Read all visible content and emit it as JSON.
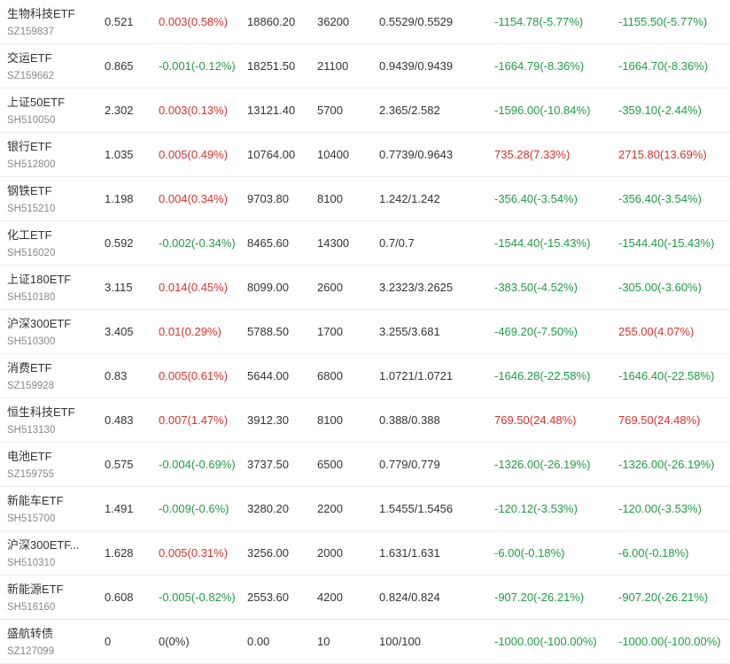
{
  "colors": {
    "up": "#d9312e",
    "down": "#1f9c45",
    "neutral": "#333333"
  },
  "rows": [
    {
      "name": "生物科技ETF",
      "code": "SZ159837",
      "price": "0.521",
      "change": "0.003(0.58%)",
      "change_dir": "up",
      "market_value": "18860.20",
      "shares": "36200",
      "cost": "0.5529/0.5529",
      "pnl": "-1154.78(-5.77%)",
      "pnl_dir": "down",
      "total_pnl": "-1155.50(-5.77%)",
      "total_pnl_dir": "down"
    },
    {
      "name": "交运ETF",
      "code": "SZ159662",
      "price": "0.865",
      "change": "-0.001(-0.12%)",
      "change_dir": "down",
      "market_value": "18251.50",
      "shares": "21100",
      "cost": "0.9439/0.9439",
      "pnl": "-1664.79(-8.36%)",
      "pnl_dir": "down",
      "total_pnl": "-1664.70(-8.36%)",
      "total_pnl_dir": "down"
    },
    {
      "name": "上证50ETF",
      "code": "SH510050",
      "price": "2.302",
      "change": "0.003(0.13%)",
      "change_dir": "up",
      "market_value": "13121.40",
      "shares": "5700",
      "cost": "2.365/2.582",
      "pnl": "-1596.00(-10.84%)",
      "pnl_dir": "down",
      "total_pnl": "-359.10(-2.44%)",
      "total_pnl_dir": "down"
    },
    {
      "name": "银行ETF",
      "code": "SH512800",
      "price": "1.035",
      "change": "0.005(0.49%)",
      "change_dir": "up",
      "market_value": "10764.00",
      "shares": "10400",
      "cost": "0.7739/0.9643",
      "pnl": "735.28(7.33%)",
      "pnl_dir": "up",
      "total_pnl": "2715.80(13.69%)",
      "total_pnl_dir": "up"
    },
    {
      "name": "钢铁ETF",
      "code": "SH515210",
      "price": "1.198",
      "change": "0.004(0.34%)",
      "change_dir": "up",
      "market_value": "9703.80",
      "shares": "8100",
      "cost": "1.242/1.242",
      "pnl": "-356.40(-3.54%)",
      "pnl_dir": "down",
      "total_pnl": "-356.40(-3.54%)",
      "total_pnl_dir": "down"
    },
    {
      "name": "化工ETF",
      "code": "SH516020",
      "price": "0.592",
      "change": "-0.002(-0.34%)",
      "change_dir": "down",
      "market_value": "8465.60",
      "shares": "14300",
      "cost": "0.7/0.7",
      "pnl": "-1544.40(-15.43%)",
      "pnl_dir": "down",
      "total_pnl": "-1544.40(-15.43%)",
      "total_pnl_dir": "down"
    },
    {
      "name": "上证180ETF",
      "code": "SH510180",
      "price": "3.115",
      "change": "0.014(0.45%)",
      "change_dir": "up",
      "market_value": "8099.00",
      "shares": "2600",
      "cost": "3.2323/3.2625",
      "pnl": "-383.50(-4.52%)",
      "pnl_dir": "down",
      "total_pnl": "-305.00(-3.60%)",
      "total_pnl_dir": "down"
    },
    {
      "name": "沪深300ETF",
      "code": "SH510300",
      "price": "3.405",
      "change": "0.01(0.29%)",
      "change_dir": "up",
      "market_value": "5788.50",
      "shares": "1700",
      "cost": "3.255/3.681",
      "pnl": "-469.20(-7.50%)",
      "pnl_dir": "down",
      "total_pnl": "255.00(4.07%)",
      "total_pnl_dir": "up"
    },
    {
      "name": "消费ETF",
      "code": "SZ159928",
      "price": "0.83",
      "change": "0.005(0.61%)",
      "change_dir": "up",
      "market_value": "5644.00",
      "shares": "6800",
      "cost": "1.0721/1.0721",
      "pnl": "-1646.28(-22.58%)",
      "pnl_dir": "down",
      "total_pnl": "-1646.40(-22.58%)",
      "total_pnl_dir": "down"
    },
    {
      "name": "恒生科技ETF",
      "code": "SH513130",
      "price": "0.483",
      "change": "0.007(1.47%)",
      "change_dir": "up",
      "market_value": "3912.30",
      "shares": "8100",
      "cost": "0.388/0.388",
      "pnl": "769.50(24.48%)",
      "pnl_dir": "up",
      "total_pnl": "769.50(24.48%)",
      "total_pnl_dir": "up"
    },
    {
      "name": "电池ETF",
      "code": "SZ159755",
      "price": "0.575",
      "change": "-0.004(-0.69%)",
      "change_dir": "down",
      "market_value": "3737.50",
      "shares": "6500",
      "cost": "0.779/0.779",
      "pnl": "-1326.00(-26.19%)",
      "pnl_dir": "down",
      "total_pnl": "-1326.00(-26.19%)",
      "total_pnl_dir": "down"
    },
    {
      "name": "新能车ETF",
      "code": "SH515700",
      "price": "1.491",
      "change": "-0.009(-0.6%)",
      "change_dir": "down",
      "market_value": "3280.20",
      "shares": "2200",
      "cost": "1.5455/1.5456",
      "pnl": "-120.12(-3.53%)",
      "pnl_dir": "down",
      "total_pnl": "-120.00(-3.53%)",
      "total_pnl_dir": "down"
    },
    {
      "name": "沪深300ETF...",
      "code": "SH510310",
      "price": "1.628",
      "change": "0.005(0.31%)",
      "change_dir": "up",
      "market_value": "3256.00",
      "shares": "2000",
      "cost": "1.631/1.631",
      "pnl": "-6.00(-0.18%)",
      "pnl_dir": "down",
      "total_pnl": "-6.00(-0.18%)",
      "total_pnl_dir": "down"
    },
    {
      "name": "新能源ETF",
      "code": "SH516160",
      "price": "0.608",
      "change": "-0.005(-0.82%)",
      "change_dir": "down",
      "market_value": "2553.60",
      "shares": "4200",
      "cost": "0.824/0.824",
      "pnl": "-907.20(-26.21%)",
      "pnl_dir": "down",
      "total_pnl": "-907.20(-26.21%)",
      "total_pnl_dir": "down"
    },
    {
      "name": "盛航转债",
      "code": "SZ127099",
      "price": "0",
      "change": "0(0%)",
      "change_dir": "flat",
      "market_value": "0.00",
      "shares": "10",
      "cost": "100/100",
      "pnl": "-1000.00(-100.00%)",
      "pnl_dir": "down",
      "total_pnl": "-1000.00(-100.00%)",
      "total_pnl_dir": "down"
    }
  ]
}
